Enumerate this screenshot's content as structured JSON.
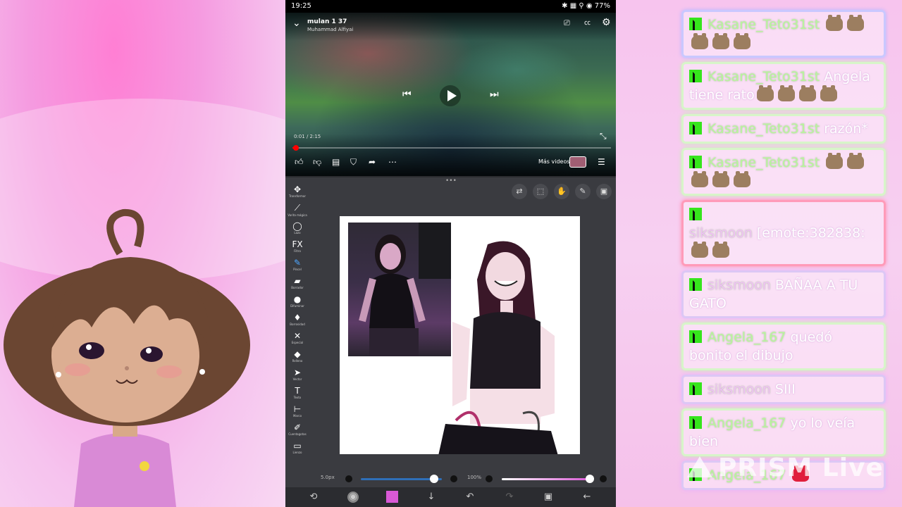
{
  "status_bar": {
    "time": "19:25",
    "right_icons": "✱ ▦ ⚲ ◉ 77%"
  },
  "video": {
    "title": "mulan 1 37",
    "channel": "Muhammad Alfiyai",
    "time": "0:01 / 2:15",
    "progress_fraction": 0.008,
    "more_videos_label": "Más videos"
  },
  "drawing_app": {
    "tools": [
      {
        "icon": "✥",
        "label": "Transformar"
      },
      {
        "icon": "⟋",
        "label": "Varita mágica"
      },
      {
        "icon": "◯",
        "label": "Lazo"
      },
      {
        "icon": "FX",
        "label": "Filtro"
      },
      {
        "icon": "✎",
        "label": "Pincel"
      },
      {
        "icon": "▰",
        "label": "Borrador"
      },
      {
        "icon": "●",
        "label": "Difuminar"
      },
      {
        "icon": "♦",
        "label": "Borrosidad"
      },
      {
        "icon": "✕",
        "label": "Especial"
      },
      {
        "icon": "◆",
        "label": "Relleno"
      },
      {
        "icon": "➤",
        "label": "Vector"
      },
      {
        "icon": "T",
        "label": "Texto"
      },
      {
        "icon": "⊢",
        "label": "Marco"
      },
      {
        "icon": "✐",
        "label": "Cuentagotas"
      },
      {
        "icon": "▭",
        "label": "Lienzo"
      }
    ],
    "top_tools": [
      "⇄",
      "⬚",
      "✋",
      "✎",
      "▣"
    ],
    "brush_size_label": "5.0px",
    "brush_size_fraction": 0.9,
    "opacity_label": "100%",
    "opacity_fraction": 1.0,
    "accent_color": "#d959d6"
  },
  "chat": {
    "messages": [
      {
        "user": "Kasane_Teto31st",
        "text": "",
        "emotes": 5,
        "border": "blue"
      },
      {
        "user": "Kasane_Teto31st",
        "text": "Angela tiene rato",
        "emotes": 4,
        "border": "green"
      },
      {
        "user": "Kasane_Teto31st",
        "text": "razón*",
        "emotes": 0,
        "border": "green"
      },
      {
        "user": "Kasane_Teto31st",
        "text": "",
        "emotes": 5,
        "border": "green"
      },
      {
        "user": "siksmoon",
        "text": "[emote:382838:",
        "emotes": 2,
        "border": "red"
      },
      {
        "user": "siksmoon",
        "text": "BAÑAA A TU GATO",
        "emotes": 0,
        "border": "lilac"
      },
      {
        "user": "Angela_167",
        "text": "quedó bonito el dibujo",
        "emotes": 0,
        "border": "green"
      },
      {
        "user": "siksmoon",
        "text": "SIII",
        "emotes": 0,
        "border": "lilac"
      },
      {
        "user": "Angela_167",
        "text": "yo lo veía bien",
        "emotes": 0,
        "border": "green"
      },
      {
        "user": "Angela_167",
        "text": "",
        "emotes": 1,
        "border": "lilac",
        "emote_color": "red"
      }
    ],
    "watermark": "PRISM Live"
  }
}
